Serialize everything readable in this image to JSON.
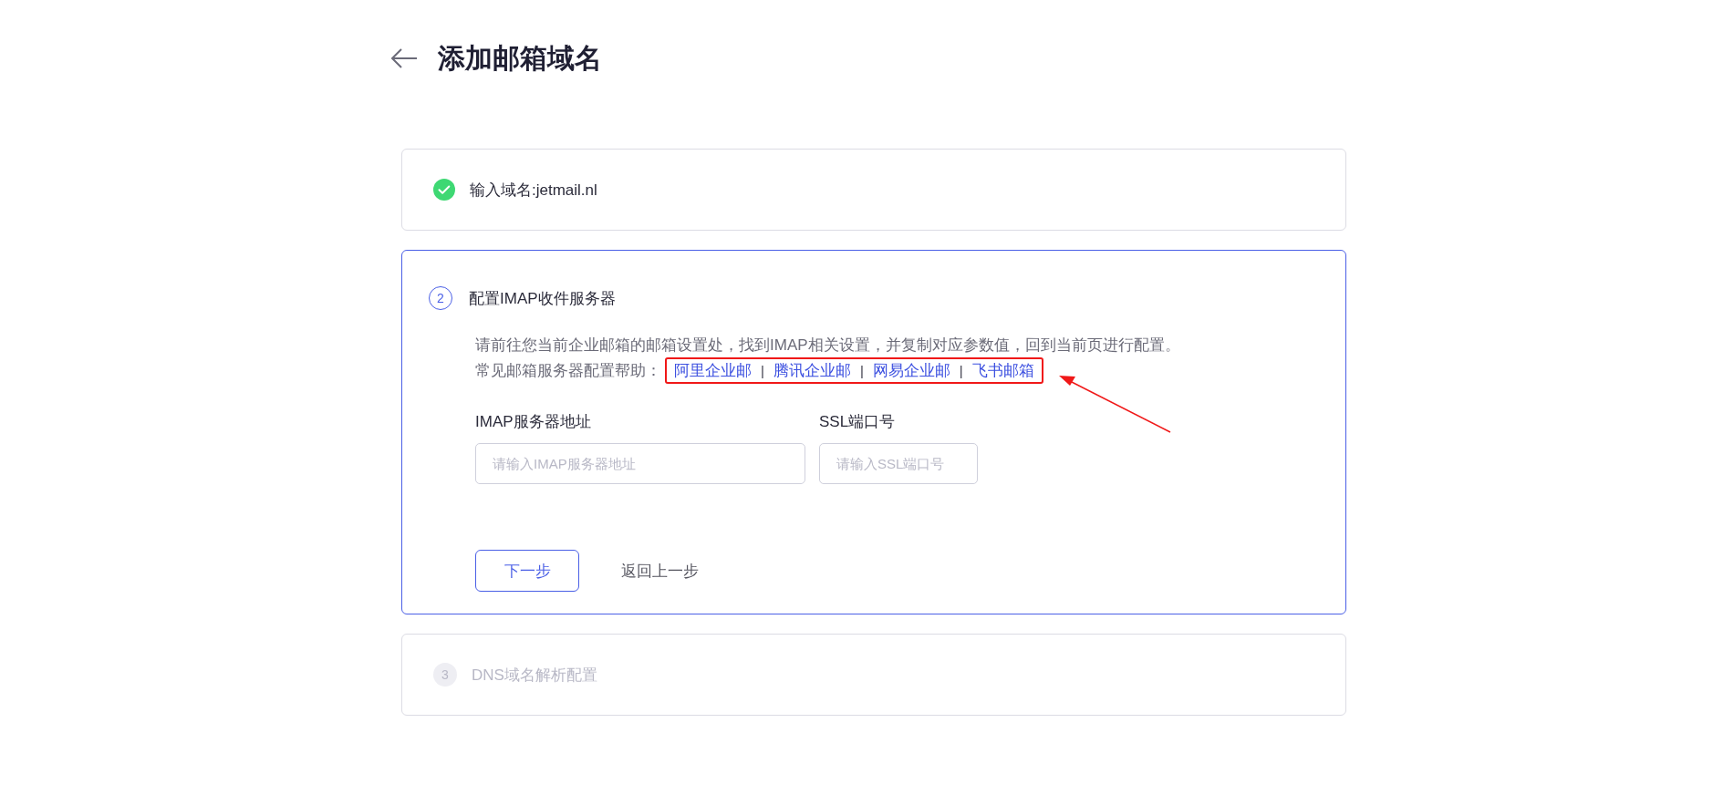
{
  "header": {
    "title": "添加邮箱域名"
  },
  "steps": [
    {
      "kind": "done",
      "title": "输入域名:jetmail.nl"
    },
    {
      "kind": "active",
      "number": "2",
      "title": "配置IMAP收件服务器",
      "description": "请前往您当前企业邮箱的邮箱设置处，找到IMAP相关设置，并复制对应参数值，回到当前页进行配置。",
      "help_label": "常见邮箱服务器配置帮助：",
      "help_links": [
        {
          "kind": "link",
          "text": "阿里企业邮"
        },
        {
          "kind": "separator",
          "text": "|"
        },
        {
          "kind": "link",
          "text": "腾讯企业邮"
        },
        {
          "kind": "separator",
          "text": "|"
        },
        {
          "kind": "link",
          "text": "网易企业邮"
        },
        {
          "kind": "separator",
          "text": "|"
        },
        {
          "kind": "link",
          "text": "飞书邮箱"
        }
      ],
      "fields": [
        {
          "label": "IMAP服务器地址",
          "placeholder": "请输入IMAP服务器地址"
        },
        {
          "label": "SSL端口号",
          "placeholder": "请输入SSL端口号"
        }
      ],
      "buttons": [
        {
          "kind": "primary",
          "label": "下一步"
        },
        {
          "kind": "text",
          "label": "返回上一步"
        }
      ]
    },
    {
      "kind": "pending",
      "number": "3",
      "title": "DNS域名解析配置"
    }
  ]
}
